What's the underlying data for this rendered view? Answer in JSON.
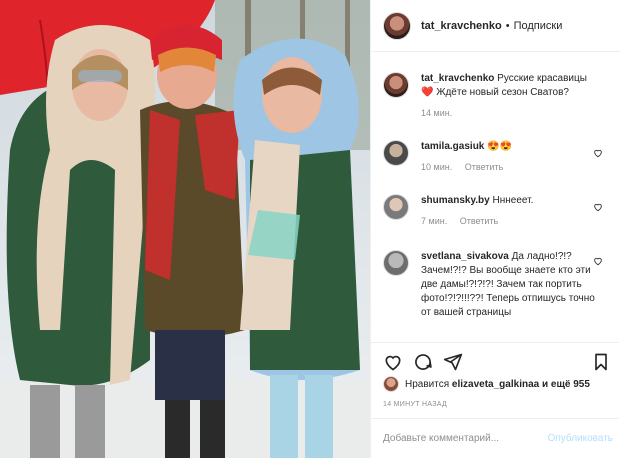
{
  "header": {
    "username": "tat_kravchenko",
    "separator": "•",
    "follow_label": "Подписки"
  },
  "caption": {
    "username": "tat_kravchenko",
    "text": "Русские красавицы ❤️ Ждёте новый сезон Сватов?",
    "time": "14 мин."
  },
  "comments": [
    {
      "username": "tamila.gasiuk",
      "text": "😍😍",
      "time": "10 мин.",
      "reply": "Ответить"
    },
    {
      "username": "shumansky.by",
      "text": "Нннееет.",
      "time": "7 мин.",
      "reply": "Ответить"
    },
    {
      "username": "svetlana_sivakova",
      "text": "Да ладно!?!? Зачем!?!? Вы вообще знаете кто эти две дамы!?!?!?! Зачем так портить фото!?!?!!!??! Теперь отпишусь точно от вашей страницы"
    }
  ],
  "likes": {
    "prefix": "Нравится",
    "user": "elizaveta_galkinaa",
    "suffix": "и ещё 955"
  },
  "post_time": "14 МИНУТ НАЗАД",
  "add_comment": {
    "placeholder": "Добавьте комментарий...",
    "publish_label": "Опубликовать"
  },
  "colors": {
    "accent_muted": "#b2dffc",
    "meta_gray": "#8e8e8e",
    "text": "#262626"
  }
}
